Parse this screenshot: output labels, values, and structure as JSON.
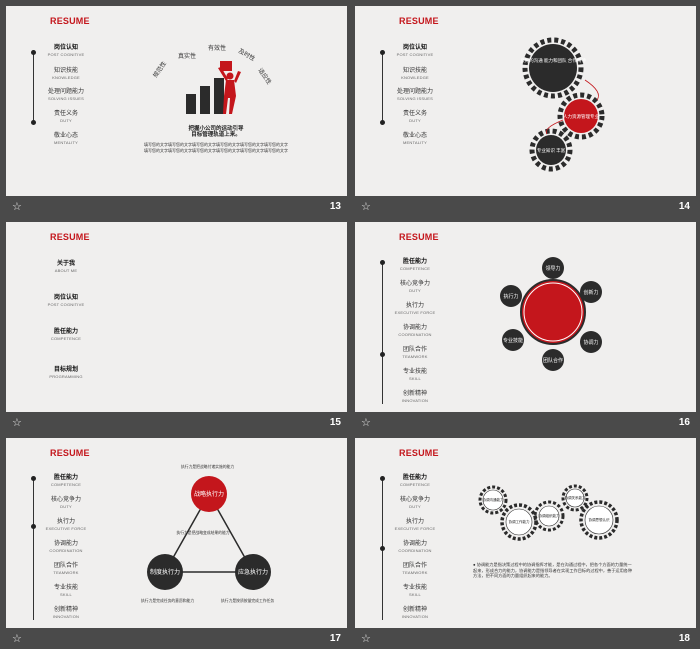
{
  "resume_label": "RESUME",
  "star_glyph": "☆",
  "menu_primary": [
    {
      "cn": "岗位认知",
      "en": "POST COGNITIVE"
    },
    {
      "cn": "知识技能",
      "en": "KNOWLEDGE"
    },
    {
      "cn": "处理问题能力",
      "en": "SOLVING ISSUES"
    },
    {
      "cn": "责任义务",
      "en": "DUTY"
    },
    {
      "cn": "敬业心态",
      "en": "MENTALITY"
    }
  ],
  "menu_overview": [
    {
      "cn": "关于我",
      "en": "ABOUT ME"
    },
    {
      "cn": "岗位认知",
      "en": "POST COGNITIVE"
    },
    {
      "cn": "胜任能力",
      "en": "COMPETENCE"
    },
    {
      "cn": "目标规划",
      "en": "PROGRAMMING"
    }
  ],
  "menu_competence": [
    {
      "cn": "胜任能力",
      "en": "COMPETENCE"
    },
    {
      "cn": "核心竞争力",
      "en": "DUTY"
    },
    {
      "cn": "执行力",
      "en": "EXECUTIVE FORCE"
    },
    {
      "cn": "协调能力",
      "en": "COORDINATION"
    },
    {
      "cn": "团队合作",
      "en": "TEAMWORK"
    },
    {
      "cn": "专业技能",
      "en": "SKILL"
    },
    {
      "cn": "创新精神",
      "en": "INNOVATION"
    }
  ],
  "slides": {
    "s13": {
      "number": "13",
      "arc_words": [
        "规范性",
        "真实性",
        "有效性",
        "及时性",
        "适应性"
      ],
      "heading1": "把握小公司的运动引导",
      "heading2": "目标管理轨道上来。",
      "body": "填写您的文字填写您的文字填写您的文字填写您的文字填写您的文字填写您的文字填写您的文字填写您的文字填写您的文字填写您的文字填写您的文字填写您的文字"
    },
    "s14": {
      "number": "14",
      "gear_top": "良好的沟通 能力和团队 合作精神",
      "gear_red": "人力资源管理专业",
      "gear_bottom": "专业知识 丰富"
    },
    "s15": {
      "number": "15"
    },
    "s16": {
      "number": "16",
      "nodes": [
        "领导力",
        "创新力",
        "执行力",
        "专业技能",
        "协调力",
        "团队合作"
      ]
    },
    "s17": {
      "number": "17",
      "red_circle": "战略执行力",
      "left_circle": "制度执行力",
      "right_circle": "应急执行力",
      "top_note": "执行力是把战略付诸实施的能力",
      "mid_note": "执行力是把战略变成结果的能力",
      "left_note": "执行力是完成任务的意愿和能力",
      "right_note": "执行力是按质按量完成工作任务"
    },
    "s18": {
      "number": "18",
      "gears": [
        "协调沟通能力",
        "协调工作能力",
        "协调组织能力",
        "协调关系能力",
        "协调思想认识"
      ],
      "body": "● 协调能力是指决策过程中的协调指挥才能，是在沟通过程中，把各个方面的力量统一起来，形成合力的能力，协调能力是指领导者在实现工作目标的过程中，善于运用各种方法，把不同方面的力量组织起来的能力。"
    }
  },
  "colors": {
    "red": "#c4161c",
    "dark": "#2b2b2b",
    "slide_bg": "#f0efee",
    "frame": "#4a4a4a"
  }
}
